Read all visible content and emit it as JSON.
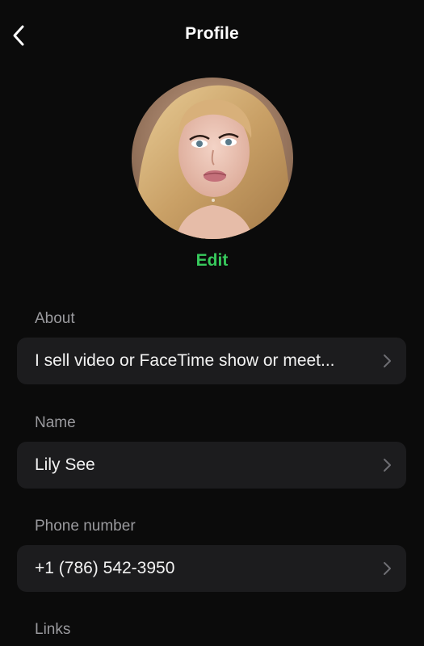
{
  "header": {
    "title": "Profile"
  },
  "icons": {
    "back": "chevron-left-icon",
    "row_chevron": "chevron-right-icon"
  },
  "colors": {
    "background": "#0b0b0b",
    "card": "#1c1c1e",
    "accent": "#37c95c",
    "label": "#9a9a9e"
  },
  "profile": {
    "edit_label": "Edit"
  },
  "sections": {
    "about": {
      "label": "About",
      "value": "I sell video or FaceTime show or meet..."
    },
    "name": {
      "label": "Name",
      "value": "Lily See"
    },
    "phone": {
      "label": "Phone number",
      "value": "+1 (786) 542-3950"
    },
    "links": {
      "label": "Links"
    }
  }
}
